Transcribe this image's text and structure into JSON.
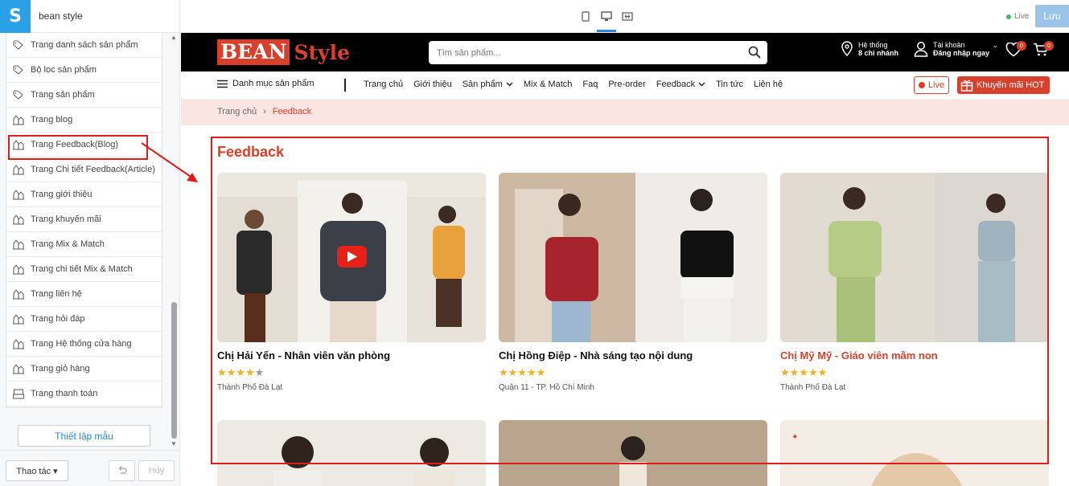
{
  "topbar": {
    "logo_letter": "S",
    "store_name": "bean style",
    "devices": [
      "tablet-icon",
      "desktop-icon",
      "fullwidth-icon"
    ],
    "live_label": "Live",
    "save_label": "Lưu"
  },
  "sidebar": {
    "items": [
      {
        "label": "Trang danh sách sản phẩm",
        "icon": "tag-icon"
      },
      {
        "label": "Bộ lọc sản phẩm",
        "icon": "tag-icon"
      },
      {
        "label": "Trang sản phẩm",
        "icon": "tag-icon"
      },
      {
        "label": "Trang blog",
        "icon": "blog-icon"
      },
      {
        "label": "Trang Feedback(Blog)",
        "icon": "blog-icon"
      },
      {
        "label": "Trang Chi tiết Feedback(Article)",
        "icon": "blog-icon"
      },
      {
        "label": "Trang giới thiệu",
        "icon": "blog-icon"
      },
      {
        "label": "Trang khuyến mãi",
        "icon": "blog-icon"
      },
      {
        "label": "Trang Mix & Match",
        "icon": "blog-icon"
      },
      {
        "label": "Trang chi tiết Mix & Match",
        "icon": "blog-icon"
      },
      {
        "label": "Trang liên hệ",
        "icon": "blog-icon"
      },
      {
        "label": "Trang hỏi đáp",
        "icon": "blog-icon"
      },
      {
        "label": "Trang Hệ thống cửa hàng",
        "icon": "blog-icon"
      },
      {
        "label": "Trang giỏ hàng",
        "icon": "blog-icon"
      },
      {
        "label": "Trang thanh toán",
        "icon": "checkout-icon"
      }
    ],
    "setup_label": "Thiết lập mẫu",
    "action_label": "Thao tác",
    "cancel_label": "Hủy"
  },
  "site": {
    "brand_part1": "BEAN",
    "brand_part2": "Style",
    "search_placeholder": "Tìm sản phẩm...",
    "store_line1": "Hệ thống",
    "store_line2": "8 chi nhánh",
    "account_line1": "Tài khoản",
    "account_line2": "Đăng nhập ngay",
    "wishlist_count": "0",
    "cart_count": "0",
    "category_menu": "Danh mục sản phẩm",
    "nav": [
      {
        "label": "Trang chủ",
        "dropdown": false
      },
      {
        "label": "Giới thiệu",
        "dropdown": false
      },
      {
        "label": "Sản phẩm",
        "dropdown": true
      },
      {
        "label": "Mix & Match",
        "dropdown": false
      },
      {
        "label": "Faq",
        "dropdown": false
      },
      {
        "label": "Pre-order",
        "dropdown": false
      },
      {
        "label": "Feedback",
        "dropdown": true
      },
      {
        "label": "Tin tức",
        "dropdown": false
      },
      {
        "label": "Liên hệ",
        "dropdown": false
      }
    ],
    "live_label": "Live",
    "promo_label": "Khuyến mãi HOT",
    "breadcrumb": {
      "home": "Trang chủ",
      "sep": "›",
      "current": "Feedback"
    },
    "section_title": "Feedback",
    "cards": [
      {
        "name": "Chị Hải Yến - Nhân viên văn phòng",
        "rating": 4,
        "location": "Thành Phố Đà Lạt",
        "highlight": false,
        "video": true
      },
      {
        "name": "Chị Hồng Điệp - Nhà sáng tạo nội dung",
        "rating": 5,
        "location": "Quận 11 - TP. Hồ Chí Minh",
        "highlight": false,
        "video": false
      },
      {
        "name": "Chị Mỹ Mỹ - Giáo viên mầm non",
        "rating": 5,
        "location": "Thành Phố Đà Lạt",
        "highlight": true,
        "video": false
      }
    ]
  },
  "colors": {
    "brand": "#d9402b",
    "accent": "#2d87d8",
    "highlight": "#e01b1b",
    "star": "#f2b01e"
  }
}
